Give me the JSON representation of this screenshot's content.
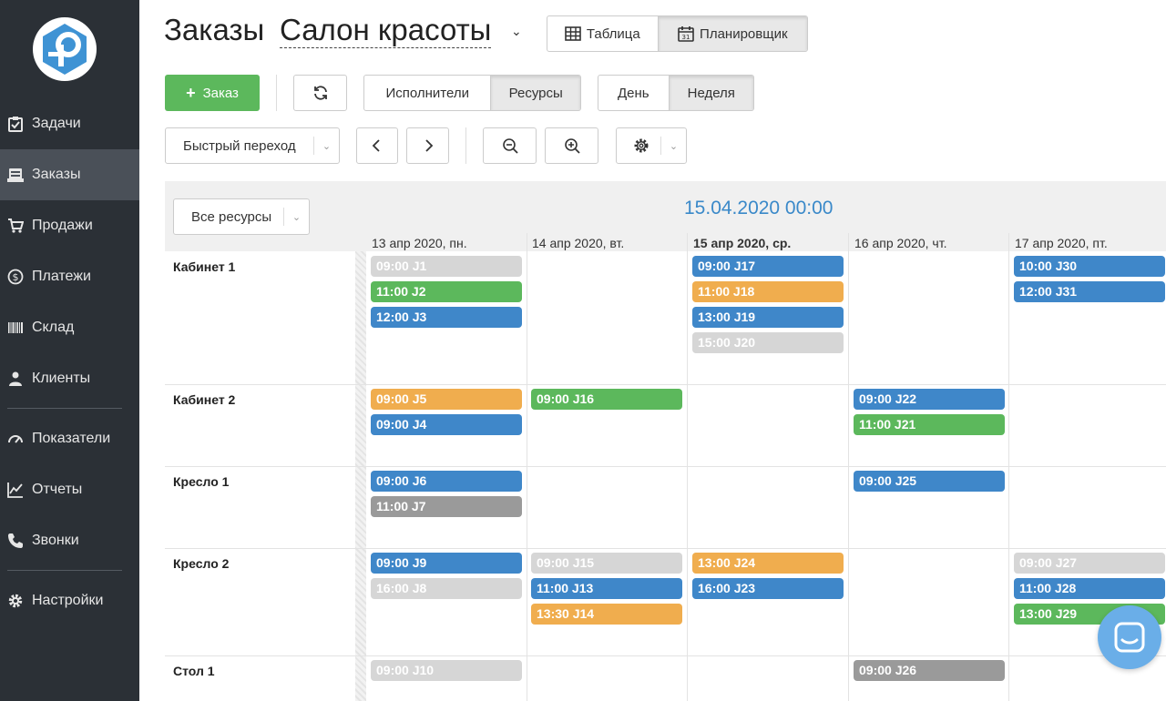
{
  "sidebar": {
    "items": [
      {
        "label": "Задачи",
        "icon": "clipboard-icon"
      },
      {
        "label": "Заказы",
        "icon": "orders-icon",
        "active": true
      },
      {
        "label": "Продажи",
        "icon": "cart-icon"
      },
      {
        "label": "Платежи",
        "icon": "dollar-icon"
      },
      {
        "label": "Склад",
        "icon": "barcode-icon"
      },
      {
        "label": "Клиенты",
        "icon": "user-icon"
      },
      {
        "label": "Показатели",
        "icon": "gauge-icon"
      },
      {
        "label": "Отчеты",
        "icon": "chart-icon"
      },
      {
        "label": "Звонки",
        "icon": "phone-icon"
      },
      {
        "label": "Настройки",
        "icon": "gear-icon"
      }
    ]
  },
  "header": {
    "title": "Заказы",
    "company": "Салон красоты",
    "view_table": "Таблица",
    "view_planner": "Планировщик"
  },
  "toolbar": {
    "add_order": "Заказ",
    "performers": "Исполнители",
    "resources": "Ресурсы",
    "day": "День",
    "week": "Неделя",
    "quick_jump": "Быстрый переход"
  },
  "calendar": {
    "resource_filter": "Все ресурсы",
    "now": "15.04.2020 00:00",
    "days": [
      "13 апр 2020, пн.",
      "14 апр 2020, вт.",
      "15 апр 2020, ср.",
      "16 апр 2020, чт.",
      "17 апр 2020, пт."
    ],
    "resources": [
      "Кабинет 1",
      "Кабинет 2",
      "Кресло 1",
      "Кресло 2",
      "Стол 1"
    ],
    "events": [
      {
        "text": "09:00 J1",
        "color": "#d6d6d6"
      },
      {
        "text": "11:00 J2",
        "color": "#5cb85c"
      },
      {
        "text": "12:00 J3",
        "color": "#3f87c9"
      },
      {
        "text": "09:00 J17",
        "color": "#3f87c9"
      },
      {
        "text": "11:00 J18",
        "color": "#f0ad4e"
      },
      {
        "text": "13:00 J19",
        "color": "#3f87c9"
      },
      {
        "text": "15:00 J20",
        "color": "#d6d6d6"
      },
      {
        "text": "10:00 J30",
        "color": "#3f87c9"
      },
      {
        "text": "12:00 J31",
        "color": "#3f87c9"
      },
      {
        "text": "09:00 J5",
        "color": "#f0ad4e"
      },
      {
        "text": "09:00 J4",
        "color": "#3f87c9"
      },
      {
        "text": "09:00 J16",
        "color": "#5cb85c"
      },
      {
        "text": "09:00 J22",
        "color": "#3f87c9"
      },
      {
        "text": "11:00 J21",
        "color": "#5cb85c"
      },
      {
        "text": "09:00 J6",
        "color": "#3f87c9"
      },
      {
        "text": "11:00 J7",
        "color": "#9a9a9a"
      },
      {
        "text": "09:00 J25",
        "color": "#3f87c9"
      },
      {
        "text": "09:00 J9",
        "color": "#3f87c9"
      },
      {
        "text": "16:00 J8",
        "color": "#d6d6d6"
      },
      {
        "text": "09:00 J15",
        "color": "#d6d6d6"
      },
      {
        "text": "11:00 J13",
        "color": "#3f87c9"
      },
      {
        "text": "13:30 J14",
        "color": "#f0ad4e"
      },
      {
        "text": "13:00 J24",
        "color": "#f0ad4e"
      },
      {
        "text": "16:00 J23",
        "color": "#3f87c9"
      },
      {
        "text": "09:00 J27",
        "color": "#d6d6d6"
      },
      {
        "text": "11:00 J28",
        "color": "#3f87c9"
      },
      {
        "text": "13:00 J29",
        "color": "#5cb85c"
      },
      {
        "text": "09:00 J10",
        "color": "#d6d6d6"
      },
      {
        "text": "09:00 J26",
        "color": "#9a9a9a"
      }
    ]
  }
}
